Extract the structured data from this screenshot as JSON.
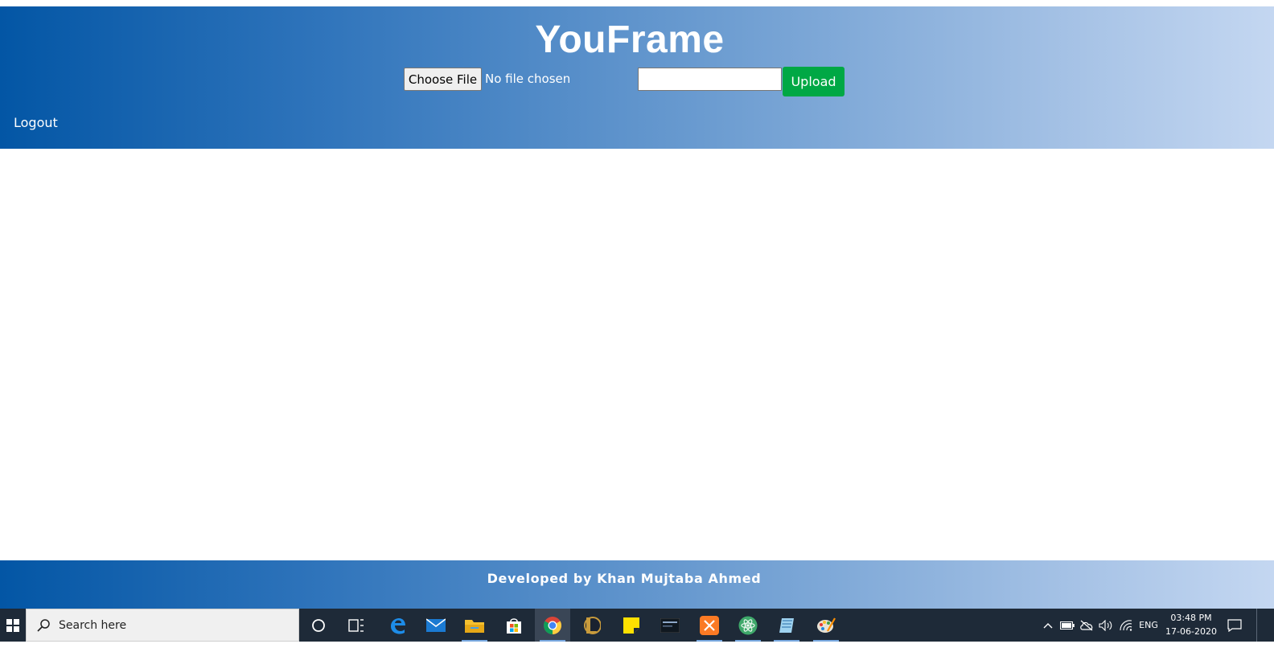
{
  "header": {
    "app_title": "YouFrame",
    "choose_file_label": "Choose File",
    "file_status": "No file chosen",
    "name_input_value": "",
    "upload_label": "Upload",
    "logout_label": "Logout"
  },
  "footer": {
    "credit": "Developed by Khan Mujtaba Ahmed"
  },
  "taskbar": {
    "search_placeholder": "Search here",
    "pinned_apps": [
      "cortana-icon",
      "task-view-icon",
      "edge-icon",
      "mail-icon",
      "file-explorer-icon",
      "store-icon",
      "chrome-icon",
      "league-of-legends-icon",
      "sticky-notes-icon",
      "mysql-icon",
      "xampp-icon",
      "atom-icon",
      "notepad-icon",
      "paint-icon"
    ],
    "tray": {
      "language": "ENG",
      "time": "03:48 PM",
      "date": "17-06-2020"
    }
  },
  "colors": {
    "header_gradient_start": "#0356a5",
    "header_gradient_end": "#c4d7f1",
    "upload_button": "#00a845",
    "taskbar": "#1e2a38"
  }
}
